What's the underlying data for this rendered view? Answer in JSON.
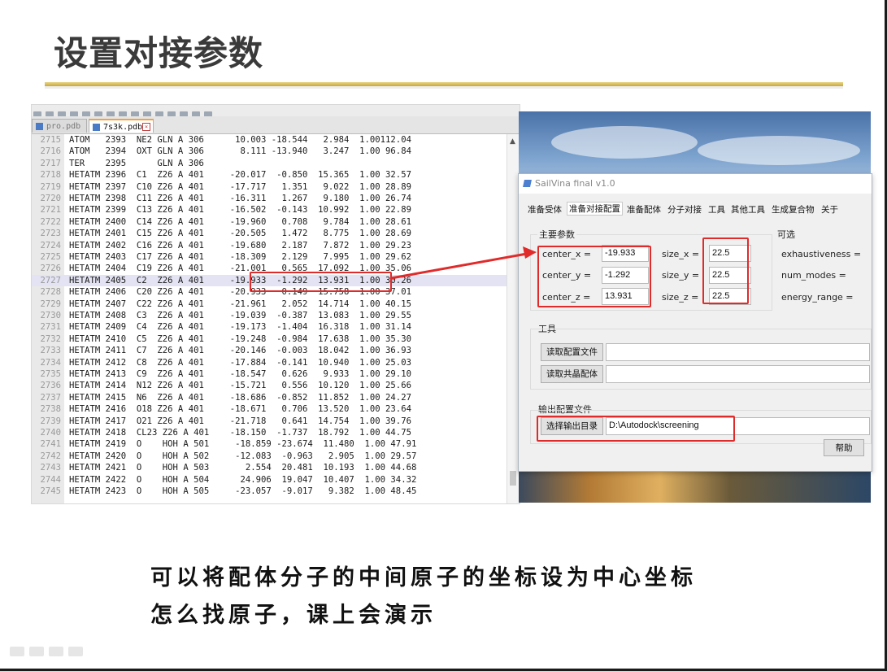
{
  "slide": {
    "title": "设置对接参数",
    "caption_line1": "可以将配体分子的中间原子的坐标设为中心坐标",
    "caption_line2": "怎么找原子，课上会演示"
  },
  "editor": {
    "tabs": [
      {
        "label": "pro.pdb",
        "active": false
      },
      {
        "label": "7s3k.pdb",
        "active": true
      }
    ],
    "rows": [
      {
        "ln": "2715",
        "text": "ATOM   2393  NE2 GLN A 306      10.003 -18.544   2.984  1.00112.04"
      },
      {
        "ln": "2716",
        "text": "ATOM   2394  OXT GLN A 306       8.111 -13.940   3.247  1.00 96.84"
      },
      {
        "ln": "2717",
        "text": "TER    2395      GLN A 306"
      },
      {
        "ln": "2718",
        "text": "HETATM 2396  C1  Z26 A 401     -20.017  -0.850  15.365  1.00 32.57"
      },
      {
        "ln": "2719",
        "text": "HETATM 2397  C10 Z26 A 401     -17.717   1.351   9.022  1.00 28.89"
      },
      {
        "ln": "2720",
        "text": "HETATM 2398  C11 Z26 A 401     -16.311   1.267   9.180  1.00 26.74"
      },
      {
        "ln": "2721",
        "text": "HETATM 2399  C13 Z26 A 401     -16.502  -0.143  10.992  1.00 22.89"
      },
      {
        "ln": "2722",
        "text": "HETATM 2400  C14 Z26 A 401     -19.960   0.708   9.784  1.00 28.61"
      },
      {
        "ln": "2723",
        "text": "HETATM 2401  C15 Z26 A 401     -20.505   1.472   8.775  1.00 28.69"
      },
      {
        "ln": "2724",
        "text": "HETATM 2402  C16 Z26 A 401     -19.680   2.187   7.872  1.00 29.23"
      },
      {
        "ln": "2725",
        "text": "HETATM 2403  C17 Z26 A 401     -18.309   2.129   7.995  1.00 29.62"
      },
      {
        "ln": "2726",
        "text": "HETATM 2404  C19 Z26 A 401     -21.001   0.565  17.092  1.00 35.06"
      },
      {
        "ln": "2727",
        "text": "HETATM 2405  C2  Z26 A 401     -19.933  -1.292  13.931  1.00 30.26"
      },
      {
        "ln": "2728",
        "text": "HETATM 2406  C20 Z26 A 401     -20.933   0.149  15.758  1.00 37.01"
      },
      {
        "ln": "2729",
        "text": "HETATM 2407  C22 Z26 A 401     -21.961   2.052  14.714  1.00 40.15"
      },
      {
        "ln": "2730",
        "text": "HETATM 2408  C3  Z26 A 401     -19.039  -0.387  13.083  1.00 29.55"
      },
      {
        "ln": "2731",
        "text": "HETATM 2409  C4  Z26 A 401     -19.173  -1.404  16.318  1.00 31.14"
      },
      {
        "ln": "2732",
        "text": "HETATM 2410  C5  Z26 A 401     -19.248  -0.984  17.638  1.00 35.30"
      },
      {
        "ln": "2733",
        "text": "HETATM 2411  C7  Z26 A 401     -20.146  -0.003  18.042  1.00 36.93"
      },
      {
        "ln": "2734",
        "text": "HETATM 2412  C8  Z26 A 401     -17.884  -0.141  10.940  1.00 25.03"
      },
      {
        "ln": "2735",
        "text": "HETATM 2413  C9  Z26 A 401     -18.547   0.626   9.933  1.00 29.10"
      },
      {
        "ln": "2736",
        "text": "HETATM 2414  N12 Z26 A 401     -15.721   0.556  10.120  1.00 25.66"
      },
      {
        "ln": "2737",
        "text": "HETATM 2415  N6  Z26 A 401     -18.686  -0.852  11.852  1.00 24.27"
      },
      {
        "ln": "2738",
        "text": "HETATM 2416  O18 Z26 A 401     -18.671   0.706  13.520  1.00 23.64"
      },
      {
        "ln": "2739",
        "text": "HETATM 2417  O21 Z26 A 401     -21.718   0.641  14.754  1.00 39.76"
      },
      {
        "ln": "2740",
        "text": "HETATM 2418  CL23 Z26 A 401    -18.150  -1.737  18.792  1.00 44.75"
      },
      {
        "ln": "2741",
        "text": "HETATM 2419  O    HOH A 501     -18.859 -23.674  11.480  1.00 47.91"
      },
      {
        "ln": "2742",
        "text": "HETATM 2420  O    HOH A 502     -12.083  -0.963   2.905  1.00 29.57"
      },
      {
        "ln": "2743",
        "text": "HETATM 2421  O    HOH A 503       2.554  20.481  10.193  1.00 44.68"
      },
      {
        "ln": "2744",
        "text": "HETATM 2422  O    HOH A 504      24.906  19.047  10.407  1.00 34.32"
      },
      {
        "ln": "2745",
        "text": "HETATM 2423  O    HOH A 505     -23.057  -9.017   9.382  1.00 48.45"
      }
    ],
    "highlight_line": "2727"
  },
  "dialog": {
    "title": "SailVina final v1.0",
    "menu": [
      "准备受体",
      "准备对接配置",
      "准备配体",
      "分子对接",
      "工具",
      "其他工具",
      "生成复合物",
      "关于"
    ],
    "main_params_label": "主要参数",
    "optional_label": "可选",
    "center_x_label": "center_x =",
    "center_y_label": "center_y =",
    "center_z_label": "center_z =",
    "center_x": "-19.933",
    "center_y": "-1.292",
    "center_z": "13.931",
    "size_x_label": "size_x =",
    "size_y_label": "size_y =",
    "size_z_label": "size_z =",
    "size_x": "22.5",
    "size_y": "22.5",
    "size_z": "22.5",
    "exhaustiveness_label": "exhaustiveness =",
    "num_modes_label": "num_modes =",
    "energy_range_label": "energy_range =",
    "tools_label": "工具",
    "read_config_button": "读取配置文件",
    "read_cocrystal_button": "读取共晶配体",
    "output_label": "输出配置文件",
    "choose_output_button": "选择输出目录",
    "output_path": "D:\\Autodock\\screening",
    "help_button": "帮助"
  },
  "colors": {
    "highlight_box": "#e02b2b",
    "title_rule": "#d8bc55"
  }
}
